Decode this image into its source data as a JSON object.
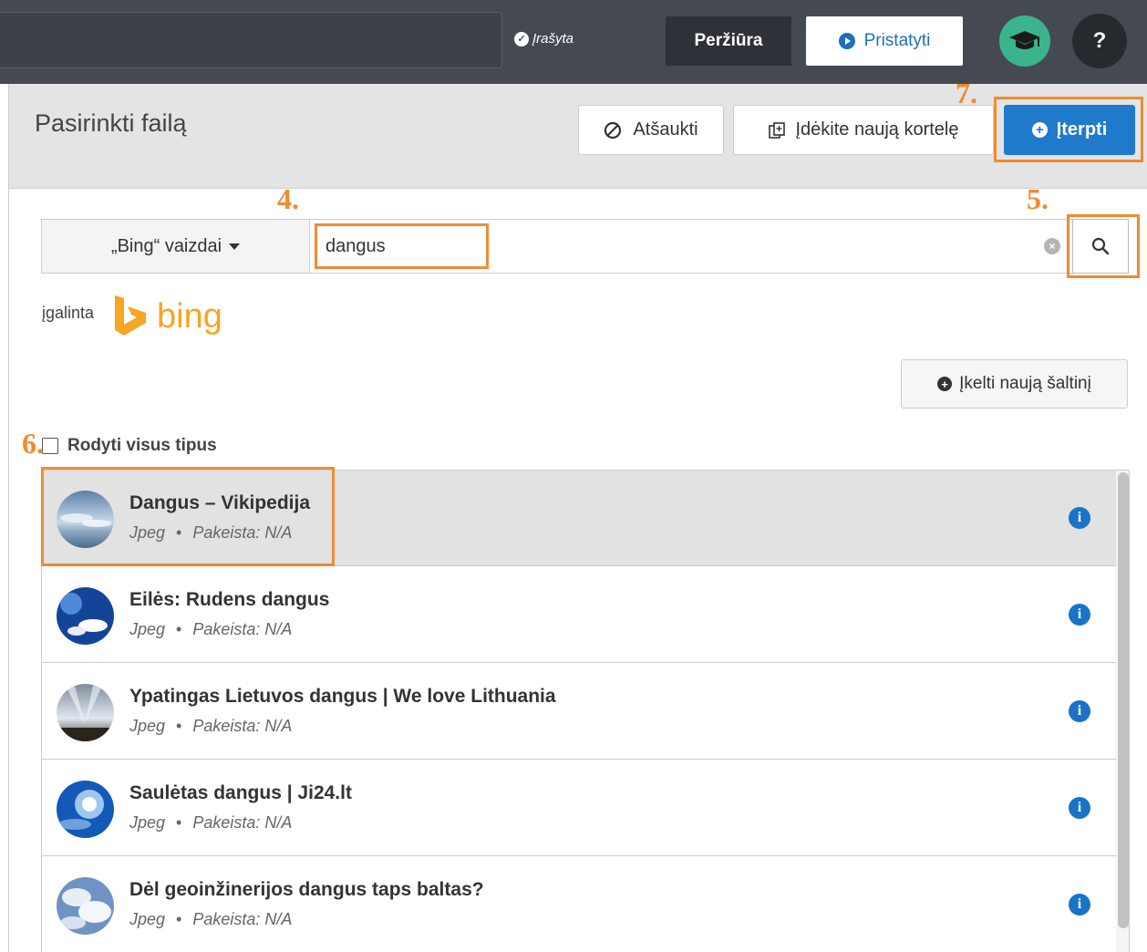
{
  "topbar": {
    "saved_label": "Įrašyta",
    "preview_label": "Peržiūra",
    "present_label": "Pristatyti",
    "help_label": "?"
  },
  "dialog": {
    "title": "Pasirinkti failą",
    "cancel_label": "Atšaukti",
    "new_card_label": "Įdėkite naują kortelę",
    "insert_label": "Įterpti"
  },
  "search": {
    "source_label": "„Bing“ vaizdai",
    "query": "dangus"
  },
  "powered_by": {
    "text": "įgalinta",
    "brand": "bing"
  },
  "upload_label": "Įkelti naują šaltinį",
  "filter": {
    "show_all_label": "Rodyti visus tipus",
    "checked": false
  },
  "results": [
    {
      "title": "Dangus – Vikipedija",
      "type": "Jpeg",
      "modified": "Pakeista: N/A",
      "selected": true
    },
    {
      "title": "Eilės: Rudens dangus",
      "type": "Jpeg",
      "modified": "Pakeista: N/A",
      "selected": false
    },
    {
      "title": "Ypatingas Lietuvos dangus | We love Lithuania",
      "type": "Jpeg",
      "modified": "Pakeista: N/A",
      "selected": false
    },
    {
      "title": "Saulėtas dangus | Ji24.lt",
      "type": "Jpeg",
      "modified": "Pakeista: N/A",
      "selected": false
    },
    {
      "title": "Dėl geoinžinerijos dangus taps baltas?",
      "type": "Jpeg",
      "modified": "Pakeista: N/A",
      "selected": false
    }
  ],
  "annotations": {
    "step4": "4.",
    "step5": "5.",
    "step6": "6.",
    "step7": "7."
  },
  "colors": {
    "accent": "#1f7acb",
    "highlight": "#f28a30",
    "bing": "#f5a623"
  }
}
